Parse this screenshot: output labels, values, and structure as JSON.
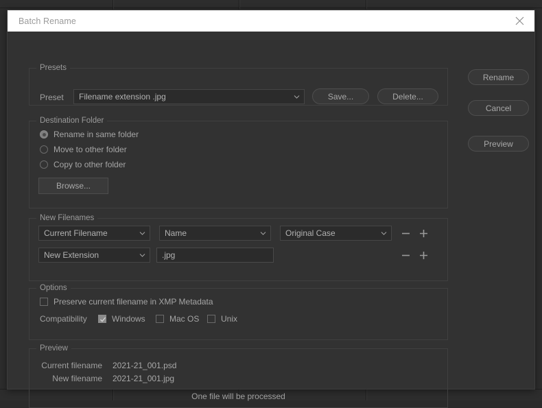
{
  "dialog": {
    "title": "Batch Rename",
    "close_icon": "close-icon"
  },
  "presets": {
    "legend": "Presets",
    "preset_label": "Preset",
    "preset_value": "Filename extension .jpg",
    "save_label": "Save...",
    "delete_label": "Delete..."
  },
  "actions": {
    "rename_label": "Rename",
    "cancel_label": "Cancel",
    "preview_label": "Preview"
  },
  "destination_folder": {
    "legend": "Destination Folder",
    "options": [
      {
        "label": "Rename in same folder",
        "checked": true
      },
      {
        "label": "Move to other folder",
        "checked": false
      },
      {
        "label": "Copy to other folder",
        "checked": false
      }
    ],
    "browse_label": "Browse..."
  },
  "new_filenames": {
    "legend": "New Filenames",
    "rows": [
      {
        "token": "Current Filename",
        "param": "Name",
        "case": "Original Case",
        "minus_icon": "minus-icon",
        "plus_icon": "plus-icon"
      },
      {
        "token": "New Extension",
        "text_value": ".jpg",
        "minus_icon": "minus-icon",
        "plus_icon": "plus-icon"
      }
    ]
  },
  "options": {
    "legend": "Options",
    "preserve_label": "Preserve current filename in XMP Metadata",
    "preserve_checked": false,
    "compatibility_label": "Compatibility",
    "compatibility": [
      {
        "label": "Windows",
        "checked": true
      },
      {
        "label": "Mac OS",
        "checked": false
      },
      {
        "label": "Unix",
        "checked": false
      }
    ]
  },
  "preview": {
    "legend": "Preview",
    "current_filename_label": "Current filename",
    "current_filename_value": "2021-21_001.psd",
    "new_filename_label": "New filename",
    "new_filename_value": "2021-21_001.jpg",
    "summary": "One file will be processed"
  },
  "colors": {
    "dialog_bg": "#323232",
    "titlebar_bg": "#ffffff",
    "field_bg": "#2b2b2b",
    "text": "#a9a9a9",
    "border": "#404040"
  }
}
